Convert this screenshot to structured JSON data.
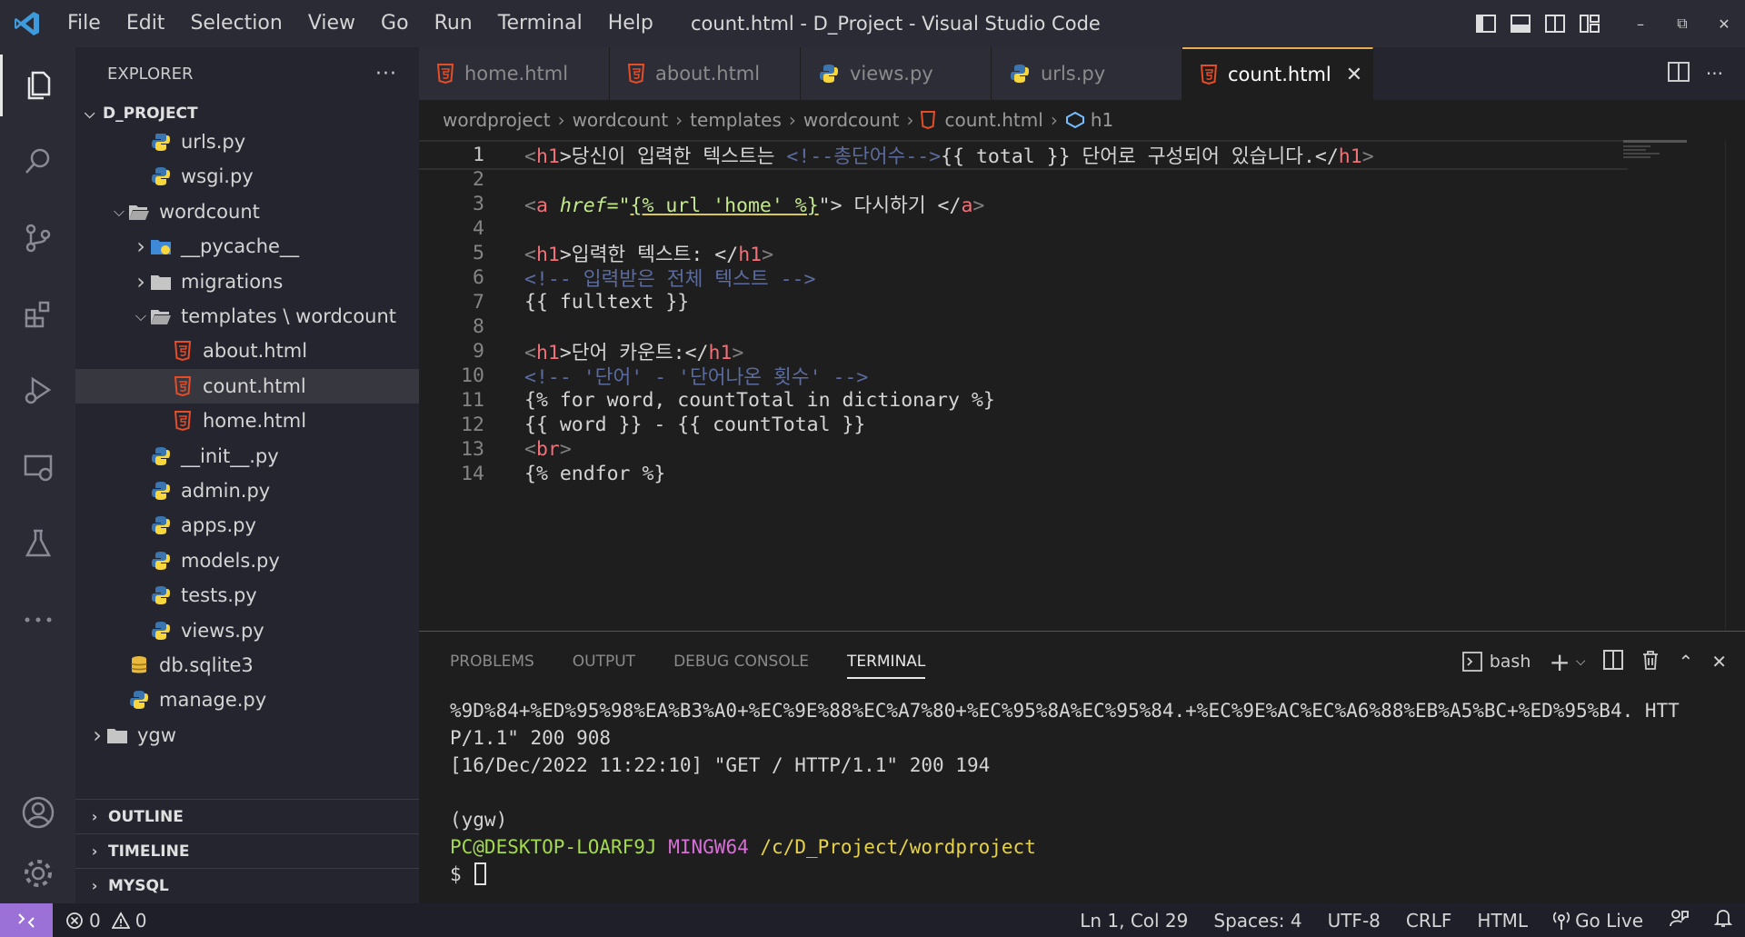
{
  "titlebar": {
    "menu": [
      "File",
      "Edit",
      "Selection",
      "View",
      "Go",
      "Run",
      "Terminal",
      "Help"
    ],
    "window_title": "count.html - D_Project - Visual Studio Code"
  },
  "sidebar": {
    "header": "EXPLORER",
    "more": "···",
    "project": "D_PROJECT",
    "tree": [
      {
        "label": "urls.py",
        "type": "python",
        "indent": 2
      },
      {
        "label": "wsgi.py",
        "type": "python",
        "indent": 2
      },
      {
        "label": "wordcount",
        "type": "folder-open",
        "indent": 1
      },
      {
        "label": "__pycache__",
        "type": "folder-special",
        "indent": 2,
        "collapsed": true
      },
      {
        "label": "migrations",
        "type": "folder",
        "indent": 2,
        "collapsed": true
      },
      {
        "label": "templates \\ wordcount",
        "type": "folder-open",
        "indent": 2
      },
      {
        "label": "about.html",
        "type": "html",
        "indent": 3
      },
      {
        "label": "count.html",
        "type": "html",
        "indent": 3,
        "selected": true
      },
      {
        "label": "home.html",
        "type": "html",
        "indent": 3
      },
      {
        "label": "__init__.py",
        "type": "python",
        "indent": 2
      },
      {
        "label": "admin.py",
        "type": "python",
        "indent": 2
      },
      {
        "label": "apps.py",
        "type": "python",
        "indent": 2
      },
      {
        "label": "models.py",
        "type": "python",
        "indent": 2
      },
      {
        "label": "tests.py",
        "type": "python",
        "indent": 2
      },
      {
        "label": "views.py",
        "type": "python",
        "indent": 2
      },
      {
        "label": "db.sqlite3",
        "type": "db",
        "indent": 1
      },
      {
        "label": "manage.py",
        "type": "python",
        "indent": 1
      },
      {
        "label": "ygw",
        "type": "folder",
        "indent": 0,
        "collapsed": true
      }
    ],
    "sections": [
      "OUTLINE",
      "TIMELINE",
      "MYSQL"
    ]
  },
  "tabs": [
    {
      "label": "home.html",
      "type": "html"
    },
    {
      "label": "about.html",
      "type": "html"
    },
    {
      "label": "views.py",
      "type": "python"
    },
    {
      "label": "urls.py",
      "type": "python"
    },
    {
      "label": "count.html",
      "type": "html",
      "active": true
    }
  ],
  "breadcrumb": [
    "wordproject",
    "wordcount",
    "templates",
    "wordcount",
    "count.html",
    "h1"
  ],
  "code_lines": [
    "1",
    "2",
    "3",
    "4",
    "5",
    "6",
    "7",
    "8",
    "9",
    "10",
    "11",
    "12",
    "13",
    "14"
  ],
  "code": {
    "l1_a": "<",
    "l1_b": "h1",
    "l1_c": ">당신이 입력한 텍스트는 ",
    "l1_d": "<!--총단어수-->",
    "l1_e": "{{ total }} 단어로 구성되어 있습니다.</",
    "l1_f": "h1",
    "l1_g": ">",
    "l3_a": "<",
    "l3_b": "a",
    "l3_c": " href",
    "l3_d": "=\"",
    "l3_e": "{% url 'home' %}",
    "l3_f": "\"> 다시하기 </",
    "l3_g": "a",
    "l3_h": ">",
    "l5_a": "<",
    "l5_b": "h1",
    "l5_c": ">입력한 텍스트: </",
    "l5_d": "h1",
    "l5_e": ">",
    "l6": "<!-- 입력받은 전체 텍스트 -->",
    "l7": "{{ fulltext }}",
    "l9_a": "<",
    "l9_b": "h1",
    "l9_c": ">단어 카운트:</",
    "l9_d": "h1",
    "l9_e": ">",
    "l10": "<!-- '단어' - '단어나온 횟수' -->",
    "l11": "{% for word, countTotal in dictionary %}",
    "l12": "{{ word }} - {{ countTotal }}",
    "l13_a": "<",
    "l13_b": "br",
    "l13_c": ">",
    "l14": "{% endfor %}"
  },
  "panel": {
    "tabs": [
      "PROBLEMS",
      "OUTPUT",
      "DEBUG CONSOLE",
      "TERMINAL"
    ],
    "active_tab": "TERMINAL",
    "shell": "bash",
    "terminal": {
      "line1": "%9D%84+%ED%95%98%EA%B3%A0+%EC%9E%88%EC%A7%80+%EC%95%8A%EC%95%84.+%EC%9E%AC%EC%A6%88%EB%A5%BC+%ED%95%B4. HTT",
      "line2": "P/1.1\" 200 908",
      "line3": "[16/Dec/2022 11:22:10] \"GET / HTTP/1.1\" 200 194",
      "line4": "",
      "line5": "(ygw)",
      "prompt_user": "PC@DESKTOP-LOARF9J",
      "prompt_env": "MINGW64",
      "prompt_path": "/c/D_Project/wordproject",
      "prompt_symbol": "$ "
    }
  },
  "statusbar": {
    "errors": "0",
    "warnings": "0",
    "position": "Ln 1, Col 29",
    "spaces": "Spaces: 4",
    "encoding": "UTF-8",
    "eol": "CRLF",
    "language": "HTML",
    "golive": "Go Live"
  },
  "colors": {
    "accent_remote": "#9b71d8",
    "html_icon": "#e44d26",
    "python_blue": "#3a75b0",
    "python_yellow": "#f7d63e"
  }
}
